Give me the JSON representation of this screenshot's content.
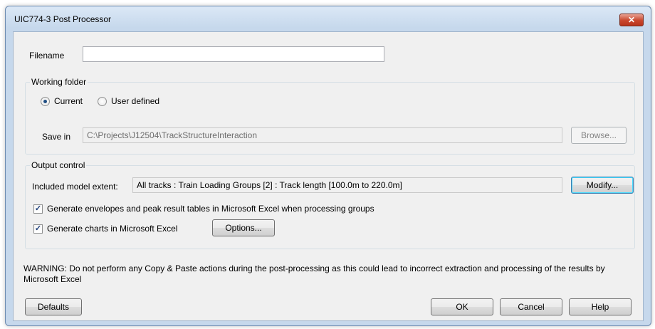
{
  "window": {
    "title": "UIC774-3 Post Processor",
    "close_glyph": "✕"
  },
  "filename": {
    "label": "Filename",
    "value": ""
  },
  "working_folder": {
    "title": "Working folder",
    "radio_current": "Current",
    "radio_user_defined": "User defined",
    "selected": "Current",
    "save_in_label": "Save in",
    "save_in_value": "C:\\Projects\\J12504\\TrackStructureInteraction",
    "browse_label": "Browse..."
  },
  "output_control": {
    "title": "Output control",
    "extent_label": "Included model extent:",
    "extent_value": "All tracks : Train Loading Groups [2] : Track length [100.0m to 220.0m]",
    "modify_label": "Modify...",
    "check_envelopes_label": "Generate envelopes and peak result tables in Microsoft Excel when processing groups",
    "check_envelopes_checked": true,
    "check_charts_label": "Generate charts in Microsoft Excel",
    "check_charts_checked": true,
    "options_label": "Options...",
    "check_glyph": "✓"
  },
  "warning_text": "WARNING: Do not perform any Copy & Paste actions during the post-processing as this could lead to incorrect extraction and processing of the results by Microsoft Excel",
  "buttons": {
    "defaults": "Defaults",
    "ok": "OK",
    "cancel": "Cancel",
    "help": "Help"
  }
}
